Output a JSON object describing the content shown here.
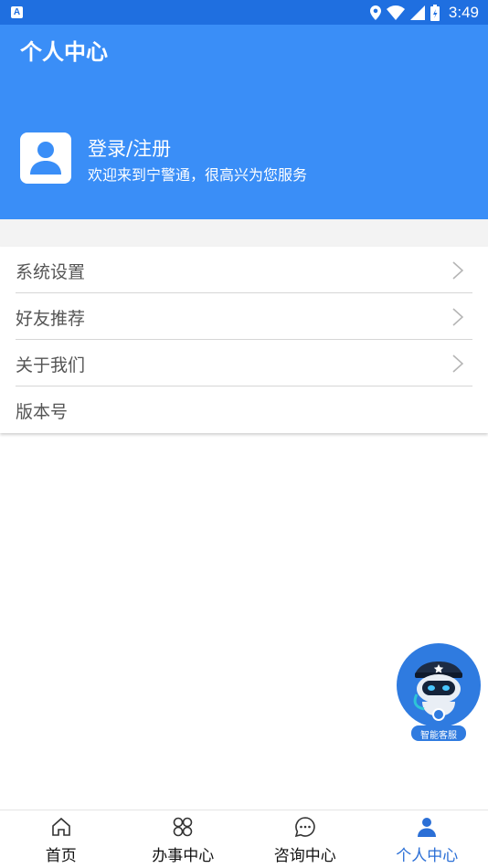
{
  "status_bar": {
    "app_icon": "A",
    "time": "3:49",
    "icons": [
      "location-icon",
      "wifi-icon",
      "signal-icon",
      "battery-icon"
    ]
  },
  "header": {
    "title": "个人中心",
    "login_label": "登录/注册",
    "welcome": "欢迎来到宁警通，很高兴为您服务"
  },
  "menu": {
    "items": [
      {
        "label": "系统设置",
        "chevron": true
      },
      {
        "label": "好友推荐",
        "chevron": true
      },
      {
        "label": "关于我们",
        "chevron": true
      },
      {
        "label": "版本号",
        "chevron": false
      }
    ]
  },
  "assistant": {
    "label": "智能客服"
  },
  "bottom_nav": {
    "items": [
      {
        "label": "首页",
        "icon": "home-icon"
      },
      {
        "label": "办事中心",
        "icon": "service-grid-icon"
      },
      {
        "label": "咨询中心",
        "icon": "chat-bubble-icon"
      },
      {
        "label": "个人中心",
        "icon": "person-icon",
        "active": true
      }
    ]
  },
  "colors": {
    "status_bar": "#1f6fe0",
    "header": "#3a8ef7",
    "active_nav": "#2b6fd6"
  }
}
